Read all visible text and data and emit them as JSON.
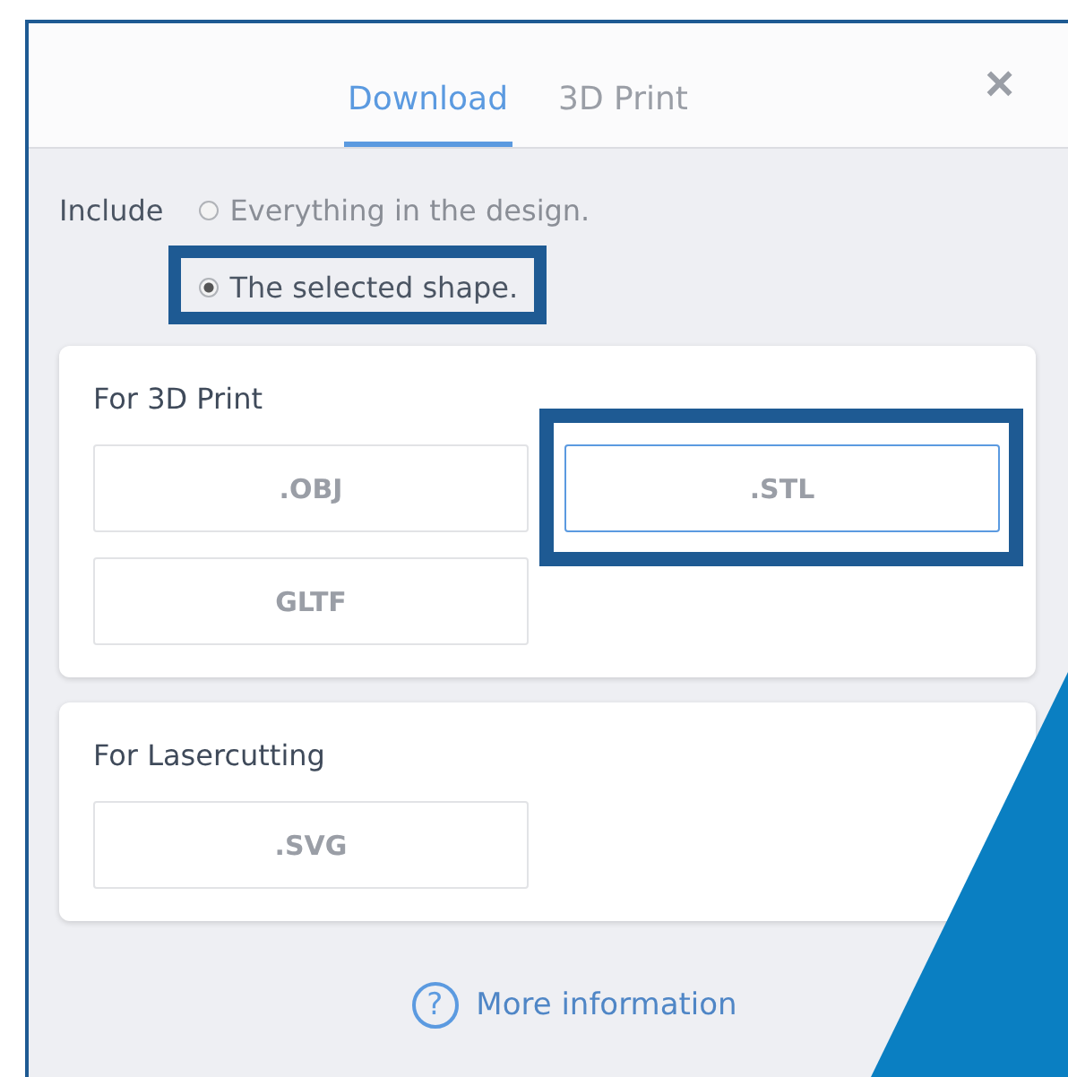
{
  "tabs": [
    {
      "label": "Download",
      "selected": true
    },
    {
      "label": "3D Print",
      "selected": false
    }
  ],
  "close": "×",
  "include": {
    "label": "Include",
    "options": [
      {
        "label": "Everything in the design.",
        "selected": false,
        "highlighted": false
      },
      {
        "label": "The selected shape.",
        "selected": true,
        "highlighted": true
      }
    ]
  },
  "sections": [
    {
      "title": "For 3D Print",
      "formats": [
        {
          "label": ".OBJ",
          "focused": false,
          "highlighted": false
        },
        {
          "label": ".STL",
          "focused": true,
          "highlighted": true
        },
        {
          "label": "GLTF",
          "focused": false,
          "highlighted": false
        }
      ]
    },
    {
      "title": "For Lasercutting",
      "formats": [
        {
          "label": ".SVG",
          "focused": false,
          "highlighted": false
        }
      ]
    }
  ],
  "help": {
    "icon": "?",
    "label": "More information"
  }
}
